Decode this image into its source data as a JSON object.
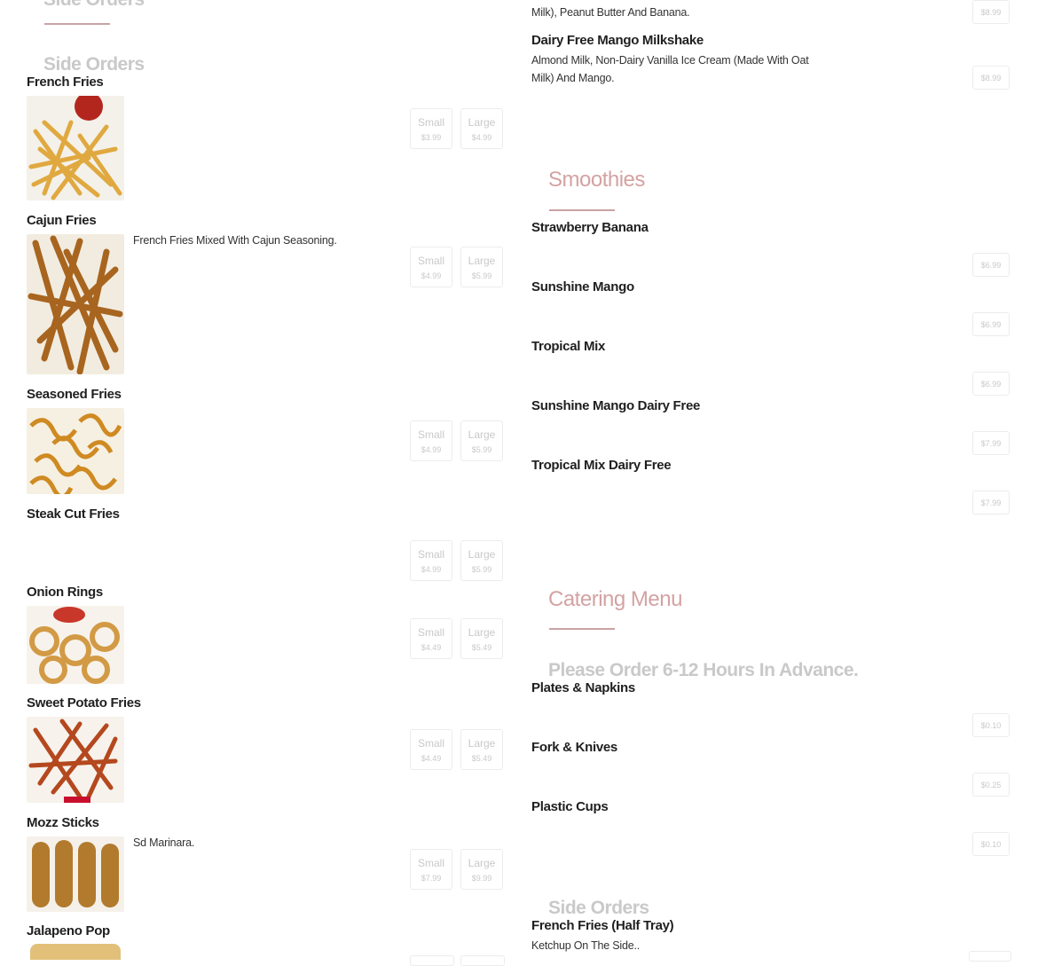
{
  "left": {
    "faded_heading": "Side Orders",
    "section_title": "Side Orders",
    "items": [
      {
        "name": "French Fries",
        "description": "",
        "small_label": "Small",
        "small_price": "$3.99",
        "large_label": "Large",
        "large_price": "$4.99"
      },
      {
        "name": "Cajun Fries",
        "description": "French Fries Mixed With Cajun Seasoning.",
        "small_label": "Small",
        "small_price": "$4.99",
        "large_label": "Large",
        "large_price": "$5.99"
      },
      {
        "name": "Seasoned Fries",
        "description": "",
        "small_label": "Small",
        "small_price": "$4.99",
        "large_label": "Large",
        "large_price": "$5.99"
      },
      {
        "name": "Steak Cut Fries",
        "description": "",
        "small_label": "Small",
        "small_price": "$4.99",
        "large_label": "Large",
        "large_price": "$5.99"
      },
      {
        "name": "Onion Rings",
        "description": "",
        "small_label": "Small",
        "small_price": "$4.49",
        "large_label": "Large",
        "large_price": "$5.49"
      },
      {
        "name": "Sweet Potato Fries",
        "description": "",
        "small_label": "Small",
        "small_price": "$4.49",
        "large_label": "Large",
        "large_price": "$5.49"
      },
      {
        "name": "Mozz Sticks",
        "description": "Sd Marinara.",
        "small_label": "Small",
        "small_price": "$7.99",
        "large_label": "Large",
        "large_price": "$9.99"
      },
      {
        "name": "Jalapeno Pop",
        "description": "",
        "small_label": "",
        "small_price": "",
        "large_label": "",
        "large_price": ""
      }
    ]
  },
  "right": {
    "top_partial_desc": "Milk), Peanut Butter And Banana.",
    "top_partial_price": "$8.99",
    "mango_item": {
      "name": "Dairy Free Mango Milkshake",
      "description": "Almond Milk, Non-Dairy Vanilla Ice Cream (Made With Oat Milk) And Mango.",
      "price": "$8.99"
    },
    "smoothies_title": "Smoothies",
    "smoothies": [
      {
        "name": "Strawberry Banana",
        "price": "$6.99"
      },
      {
        "name": "Sunshine Mango",
        "price": "$6.99"
      },
      {
        "name": "Tropical Mix",
        "price": "$6.99"
      },
      {
        "name": "Sunshine Mango Dairy Free",
        "price": "$7.99"
      },
      {
        "name": "Tropical Mix Dairy Free",
        "price": "$7.99"
      }
    ],
    "catering_title": "Catering Menu",
    "catering_notice": "Please Order 6-12 Hours In Advance.",
    "catering": [
      {
        "name": "Plates & Napkins",
        "price": "$0.10"
      },
      {
        "name": "Fork & Knives",
        "price": "$0.25"
      },
      {
        "name": "Plastic Cups",
        "price": "$0.10"
      }
    ],
    "side_orders_title": "Side Orders",
    "side_item": {
      "name": "French Fries (Half Tray)",
      "description": "Ketchup On The Side.."
    }
  },
  "colors": {
    "accent_title": "#d4a2a2",
    "muted": "#c9c9c9",
    "text": "#1f1f1f"
  }
}
